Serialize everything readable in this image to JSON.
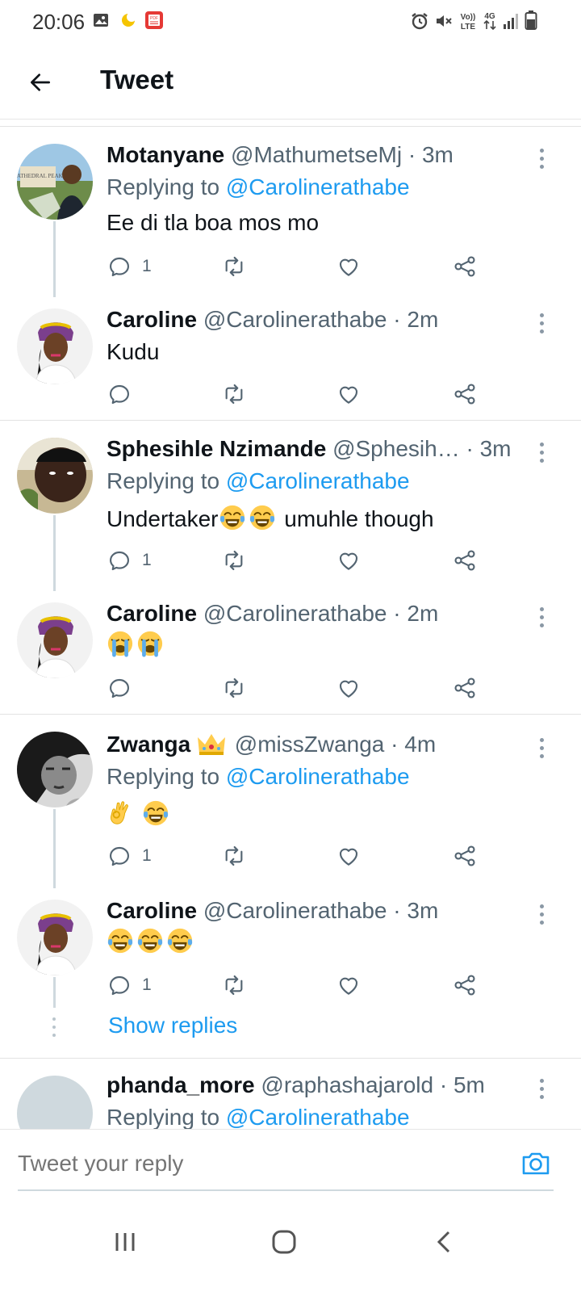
{
  "status_bar": {
    "time": "20:06",
    "left_icons": [
      "gallery-icon",
      "moon-icon",
      "pdf-icon"
    ],
    "right_icons": [
      "alarm-icon",
      "mute-icon",
      "volte-icon",
      "4g-icon",
      "signal-icon",
      "battery-icon"
    ],
    "volte_label": "Vo)) LTE",
    "network_label": "4G"
  },
  "header": {
    "title": "Tweet"
  },
  "tweets": [
    {
      "name": "Motanyane",
      "handle": "@MathumetseMj",
      "dot": "·",
      "time": "3m",
      "replying_prefix": "Replying to",
      "replying_to": "@Carolinerathabe",
      "text": "Ee di tla boa mos mo",
      "reply_count": "1"
    },
    {
      "name": "Caroline",
      "handle": "@Carolinerathabe",
      "dot": "·",
      "time": "2m",
      "text": "Kudu",
      "reply_count": ""
    },
    {
      "name": "Sphesihle Nzimande",
      "handle": "@Sphesih…",
      "dot": "·",
      "time": "3m",
      "replying_prefix": "Replying to",
      "replying_to": "@Carolinerathabe",
      "text_before": "Undertaker",
      "text_after": " umuhle though",
      "emojis": [
        "tears-of-joy",
        "tears-of-joy"
      ],
      "reply_count": "1"
    },
    {
      "name": "Caroline",
      "handle": "@Carolinerathabe",
      "dot": "·",
      "time": "2m",
      "emojis": [
        "loudly-crying",
        "loudly-crying"
      ],
      "reply_count": ""
    },
    {
      "name": "Zwanga",
      "name_badge": "crown-emoji",
      "handle": "@missZwanga",
      "dot": "·",
      "time": "4m",
      "replying_prefix": "Replying to",
      "replying_to": "@Carolinerathabe",
      "emojis": [
        "ok-hand",
        "tears-of-joy"
      ],
      "reply_count": "1"
    },
    {
      "name": "Caroline",
      "handle": "@Carolinerathabe",
      "dot": "·",
      "time": "3m",
      "emojis": [
        "tears-of-joy",
        "tears-of-joy",
        "tears-of-joy"
      ],
      "reply_count": "1"
    },
    {
      "name": "phanda_more",
      "handle": "@raphashajarold",
      "dot": "·",
      "time": "5m",
      "replying_prefix": "Replying to",
      "replying_to": "@Carolinerathabe"
    }
  ],
  "show_replies": "Show replies",
  "reply_bar": {
    "placeholder": "Tweet your reply"
  },
  "colors": {
    "accent": "#1d9bf0",
    "secondary_text": "#536471",
    "primary_text": "#0f1419"
  }
}
